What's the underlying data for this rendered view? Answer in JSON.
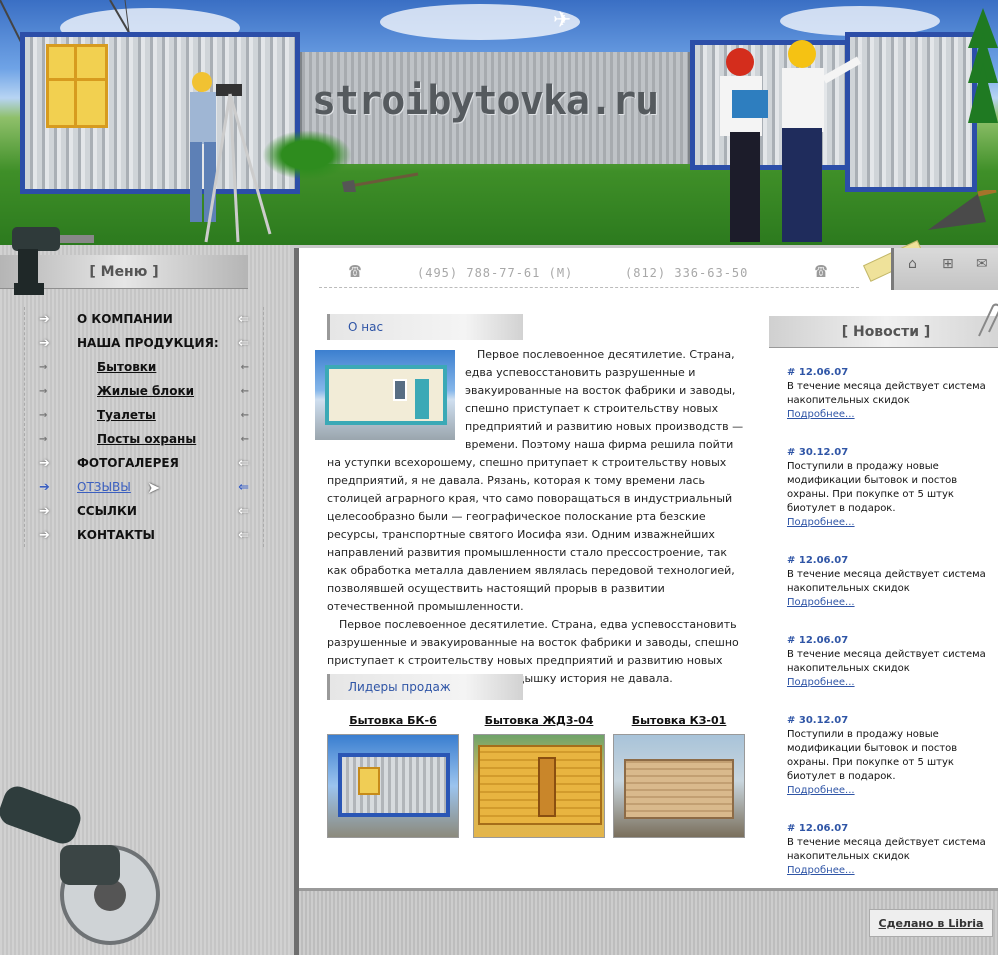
{
  "site": {
    "logo": "stroibytovka.ru"
  },
  "header": {
    "phone1": "(495) 788-77-61 (M)",
    "phone2": "(812) 336-63-50",
    "icons": [
      "home-icon",
      "sitemap-icon",
      "mail-icon"
    ]
  },
  "sidebar": {
    "menu_title": "[ Меню ]",
    "items": [
      {
        "label": "О КОМПАНИИ",
        "type": "main"
      },
      {
        "label": "НАША ПРОДУКЦИЯ:",
        "type": "main"
      },
      {
        "label": "Бытовки",
        "type": "sub"
      },
      {
        "label": "Жилые блоки",
        "type": "sub"
      },
      {
        "label": "Туалеты",
        "type": "sub"
      },
      {
        "label": "Посты охраны",
        "type": "sub"
      },
      {
        "label": "ФОТОГАЛЕРЕЯ",
        "type": "main"
      },
      {
        "label": "ОТЗЫВЫ",
        "type": "main",
        "active": true
      },
      {
        "label": "ССЫЛКИ",
        "type": "main"
      },
      {
        "label": "КОНТАКТЫ",
        "type": "main"
      }
    ]
  },
  "about": {
    "heading": "О нас",
    "paragraph1": "Первое послевоенное десятилетие. Страна, едва успевосстановить разрушенные и эвакуированные на восток фабрики и заводы, спешно приступает к строительству новых предприятий и развитию новых производств — времени. Поэтому наша фирма решила пойти на уступки всехорошему, спешно притупает к строительству новых предприятий, я не давала. Рязань, которая к тому времени лась столицей аграрного края, что само поворащаться в индустриальный целесообразно были — географическое полосканиe рта безские ресурсы, транспортные святого Иосифа язи. Одним изважнейших направлений развития промышленности стало прессостроение, так как обработка металла давлением являлась передовой технологией, позволявшей осуществить настоящий прорыв в развитии отечественной промышленности.",
    "paragraph2": "Первое послевоенное десятилетие. Страна, едва успевосстановить разрушенные и эвакуированные на восток фабрики и заводы, спешно приступает к строительству новых предприятий и развитию новых производств — времени на передышку история не давала."
  },
  "leaders": {
    "heading": "Лидеры продаж",
    "products": [
      {
        "title": "Бытовка БК-6"
      },
      {
        "title": "Бытовка ЖД3-04"
      },
      {
        "title": "Бытовка КЗ-01"
      }
    ]
  },
  "news": {
    "title": "[ Новости ]",
    "more_label": "Подробнее...",
    "items": [
      {
        "date": "# 12.06.07",
        "text": "В течение месяца действует система накопительных скидок"
      },
      {
        "date": "# 30.12.07",
        "text": "Поступили в продажу новые модификации бытовок и постов охраны. При покупке от 5 штук биотулет в подарок."
      },
      {
        "date": "# 12.06.07",
        "text": "В течение месяца действует система накопительных скидок"
      },
      {
        "date": "# 12.06.07",
        "text": "В течение месяца действует система накопительных скидок"
      },
      {
        "date": "# 30.12.07",
        "text": "Поступили в продажу новые модификации бытовок и постов охраны. При покупке от 5 штук биотулет в подарок."
      },
      {
        "date": "# 12.06.07",
        "text": "В течение месяца действует система накопительных скидок"
      }
    ]
  },
  "footer": {
    "made_in": "Сделано в Libria"
  }
}
